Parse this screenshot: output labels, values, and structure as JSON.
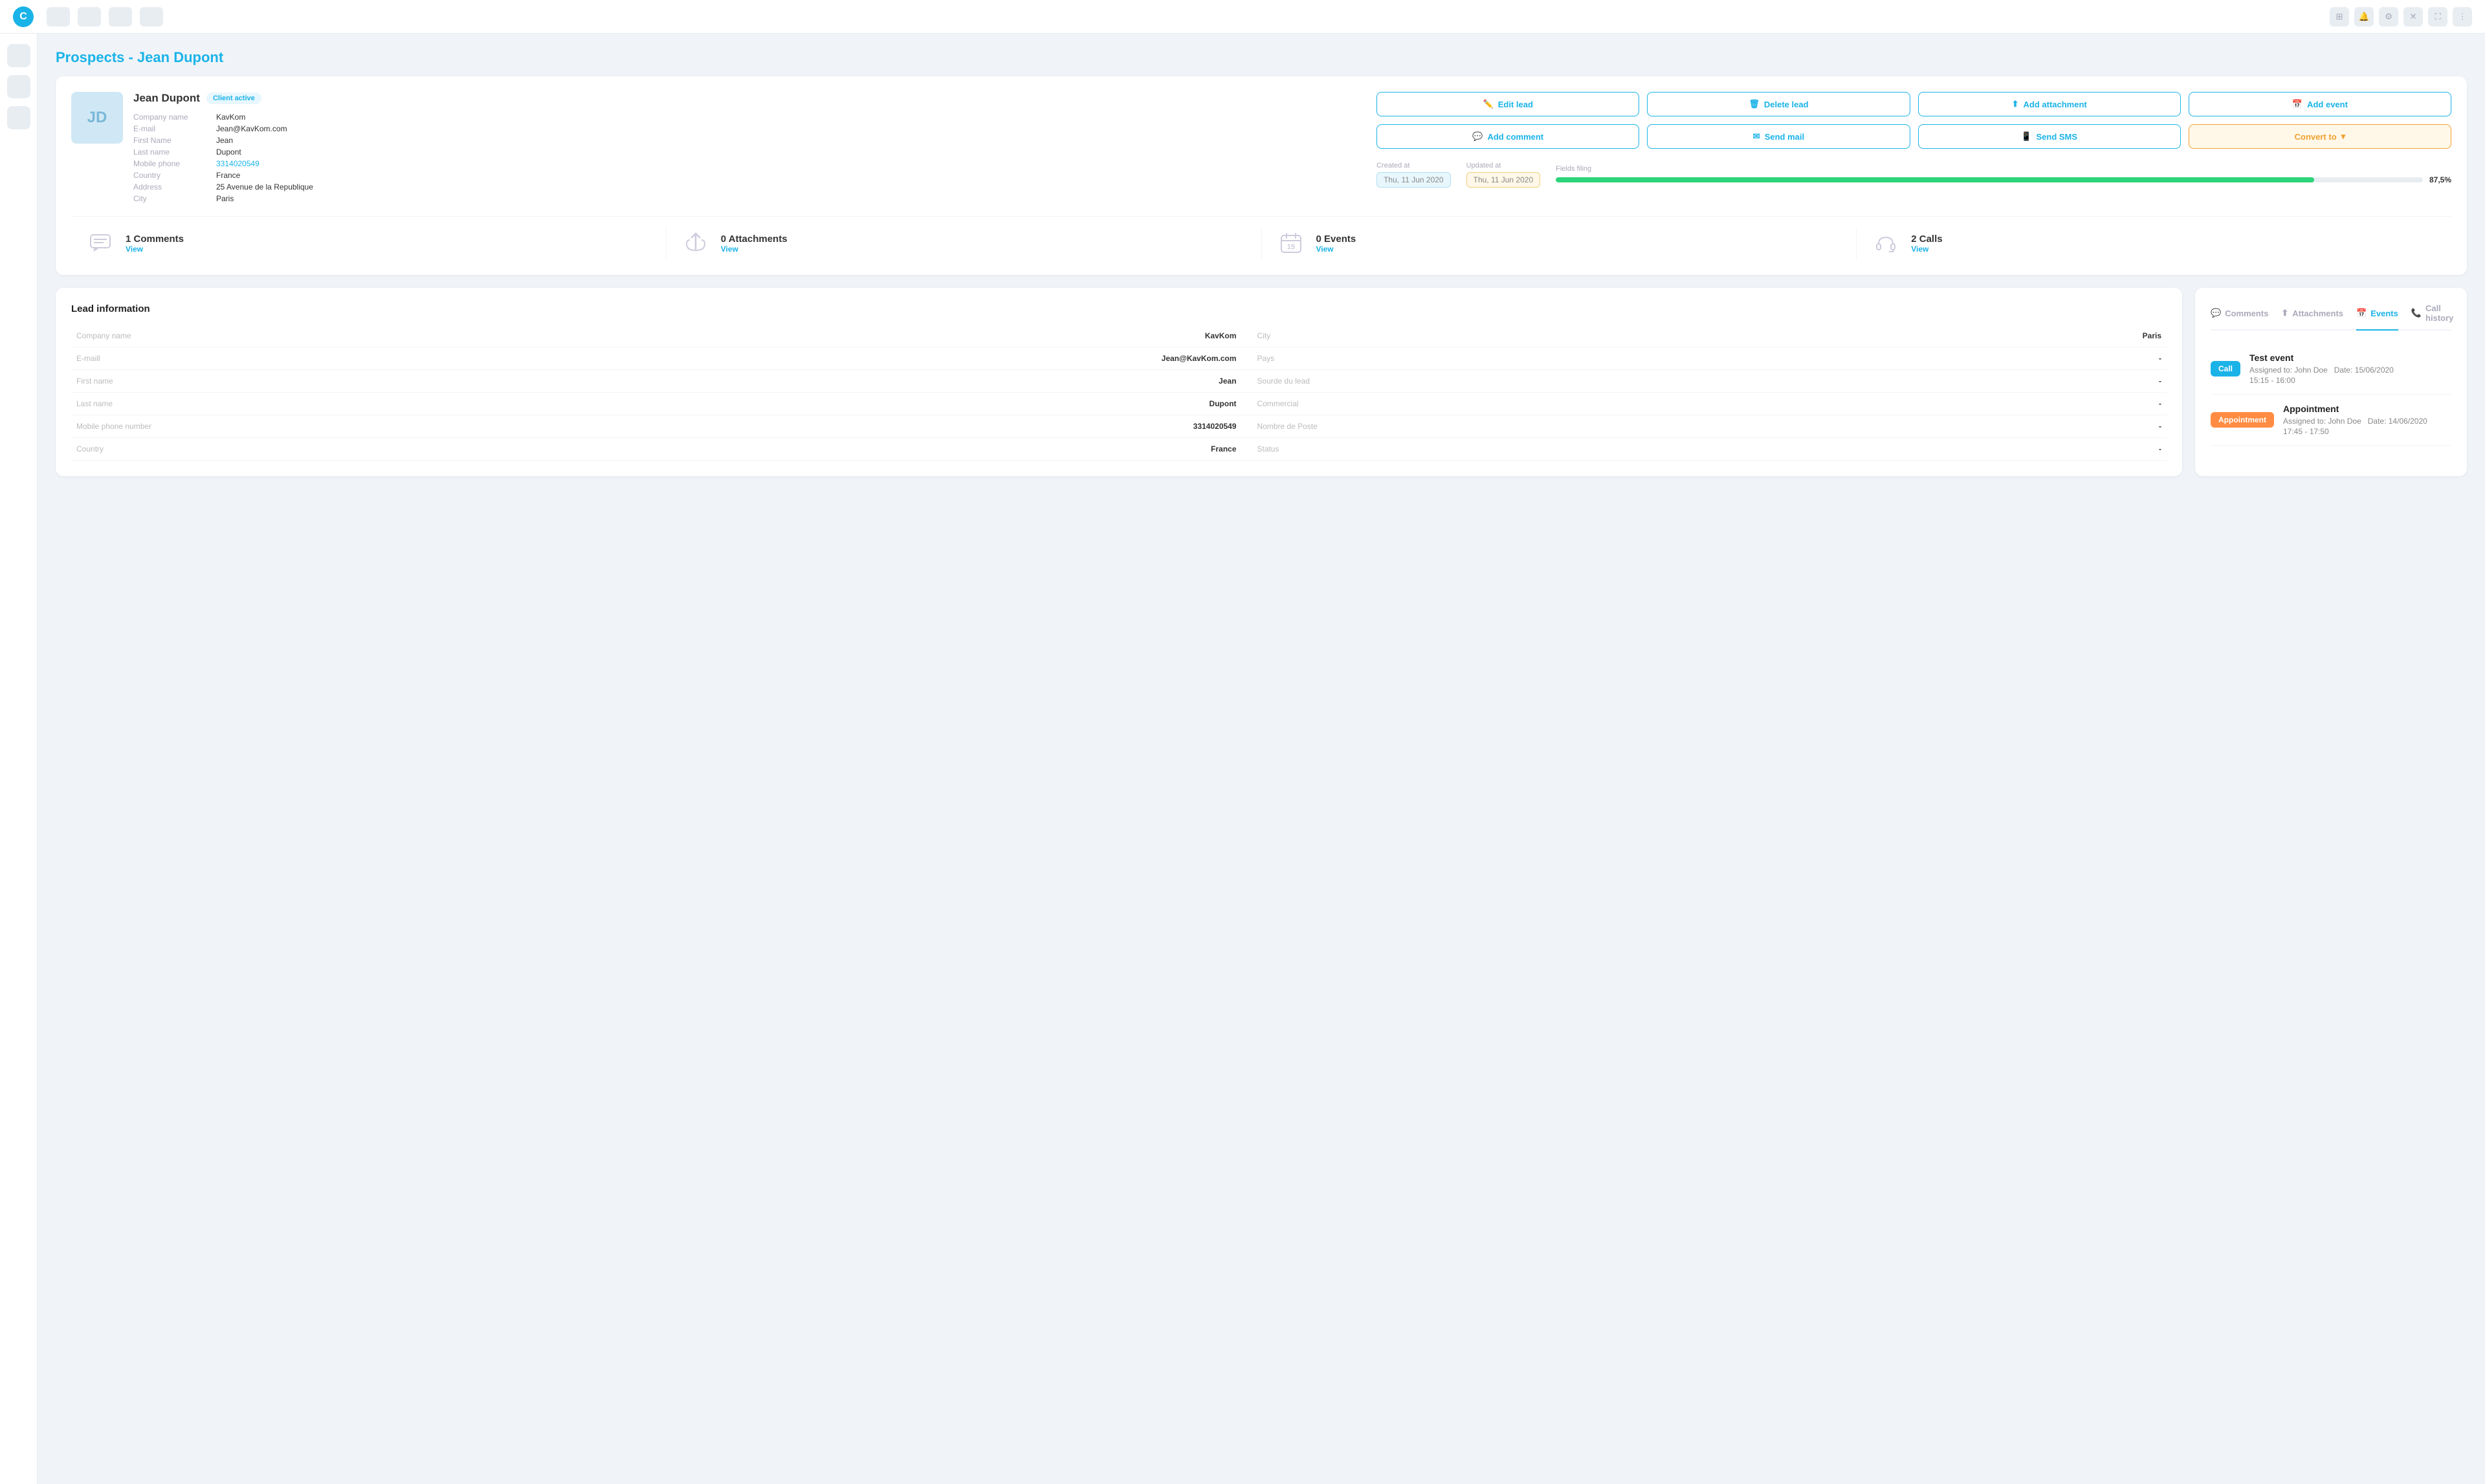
{
  "app": {
    "logo": "C",
    "title": "Prospects - Jean Dupont"
  },
  "nav": {
    "buttons": [
      "",
      "",
      "",
      ""
    ],
    "icons": [
      "grid-icon",
      "bell-icon",
      "settings-icon",
      "close-icon",
      "expand-icon",
      "more-icon"
    ]
  },
  "sidebar": {
    "items": [
      "sidebar-item-1",
      "sidebar-item-2",
      "sidebar-item-3"
    ]
  },
  "lead": {
    "initials": "JD",
    "name": "Jean Dupont",
    "status": "Client active",
    "fields": {
      "company_name_label": "Company name",
      "company_name_value": "KavKom",
      "email_label": "E-mail",
      "email_value": "Jean@KavKom.com",
      "first_name_label": "First Name",
      "first_name_value": "Jean",
      "last_name_label": "Last name",
      "last_name_value": "Dupont",
      "mobile_phone_label": "Mobile phone",
      "mobile_phone_value": "3314020549",
      "country_label": "Country",
      "country_value": "France",
      "address_label": "Address",
      "address_value": "25 Avenue de la Republique",
      "city_label": "City",
      "city_value": "Paris"
    }
  },
  "actions": {
    "edit_lead": "Edit lead",
    "delete_lead": "Delete lead",
    "add_attachment": "Add attachment",
    "add_event": "Add event",
    "add_comment": "Add comment",
    "send_mail": "Send mail",
    "send_sms": "Send SMS",
    "convert_to": "Convert to"
  },
  "dates": {
    "created_label": "Created at",
    "created_value": "Thu, 11 Jun 2020",
    "updated_label": "Updated at",
    "updated_value": "Thu, 11 Jun 2020",
    "fields_filing_label": "Fields filing",
    "fields_filing_pct": "87,5%",
    "fields_filing_progress": 87.5
  },
  "stats": [
    {
      "count": "1 Comments",
      "view": "View",
      "icon": "comment-icon"
    },
    {
      "count": "0 Attachments",
      "view": "View",
      "icon": "attachment-icon"
    },
    {
      "count": "0 Events",
      "view": "View",
      "icon": "calendar-icon"
    },
    {
      "count": "2 Calls",
      "view": "View",
      "icon": "headset-icon"
    }
  ],
  "lead_info": {
    "title": "Lead information",
    "rows": [
      {
        "label": "Company name",
        "value": "KavKom",
        "label2": "City",
        "value2": "Paris"
      },
      {
        "label": "E-maill",
        "value": "Jean@KavKom.com",
        "label2": "Pays",
        "value2": "-"
      },
      {
        "label": "First name",
        "value": "Jean",
        "label2": "Sourde du lead",
        "value2": "-"
      },
      {
        "label": "Last name",
        "value": "Dupont",
        "label2": "Commercial",
        "value2": "-"
      },
      {
        "label": "Mobile phone number",
        "value": "3314020549",
        "label2": "Nombre de Poste",
        "value2": "-"
      },
      {
        "label": "Country",
        "value": "France",
        "label2": "Status",
        "value2": "-"
      }
    ]
  },
  "events_panel": {
    "tabs": [
      {
        "label": "Comments",
        "icon": "comment-icon",
        "active": false
      },
      {
        "label": "Attachments",
        "icon": "attachment-icon",
        "active": false
      },
      {
        "label": "Events",
        "icon": "calendar-icon",
        "active": true
      },
      {
        "label": "Call history",
        "icon": "phone-icon",
        "active": false
      }
    ],
    "events": [
      {
        "type": "Call",
        "type_class": "call",
        "title": "Test event",
        "assigned": "Assigned to: John Doe",
        "date": "Date: 15/06/2020",
        "time": "15:15 - 16:00"
      },
      {
        "type": "Appointment",
        "type_class": "appointment",
        "title": "Appointment",
        "assigned": "Assigned to: John Doe",
        "date": "Date: 14/06/2020",
        "time": "17:45 - 17:50"
      }
    ]
  }
}
